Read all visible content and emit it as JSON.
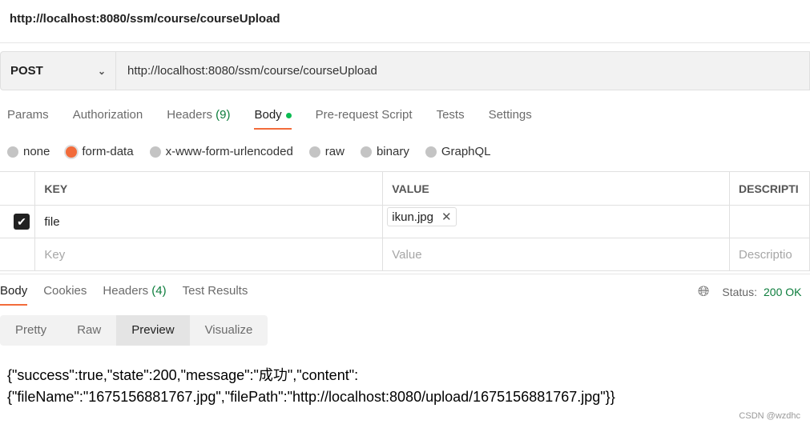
{
  "title": "http://localhost:8080/ssm/course/courseUpload",
  "request": {
    "method": "POST",
    "url": "http://localhost:8080/ssm/course/courseUpload"
  },
  "req_tabs": [
    {
      "label": "Params"
    },
    {
      "label": "Authorization"
    },
    {
      "label": "Headers",
      "count": "(9)"
    },
    {
      "label": "Body"
    },
    {
      "label": "Pre-request Script"
    },
    {
      "label": "Tests"
    },
    {
      "label": "Settings"
    }
  ],
  "body_types": [
    "none",
    "form-data",
    "x-www-form-urlencoded",
    "raw",
    "binary",
    "GraphQL"
  ],
  "selected_body_type": "form-data",
  "table": {
    "headers": [
      "KEY",
      "VALUE",
      "DESCRIPTI"
    ],
    "row": {
      "key": "file",
      "value": "ikun.jpg",
      "checked": true
    },
    "placeholders": {
      "key": "Key",
      "value": "Value",
      "description": "Descriptio"
    }
  },
  "resp_tabs": [
    {
      "label": "Body"
    },
    {
      "label": "Cookies"
    },
    {
      "label": "Headers",
      "count": "(4)"
    },
    {
      "label": "Test Results"
    }
  ],
  "status": {
    "label": "Status:",
    "value": "200 OK"
  },
  "view_modes": [
    "Pretty",
    "Raw",
    "Preview",
    "Visualize"
  ],
  "selected_view": "Preview",
  "response": {
    "line1": "{\"success\":true,\"state\":200,\"message\":\"成功\",\"content\":",
    "line2": "{\"fileName\":\"1675156881767.jpg\",\"filePath\":\"http://localhost:8080/upload/1675156881767.jpg\"}}"
  },
  "watermark": "CSDN @wzdhc",
  "colors": {
    "accent": "#f26b3a",
    "status": "#0c7d3c"
  }
}
